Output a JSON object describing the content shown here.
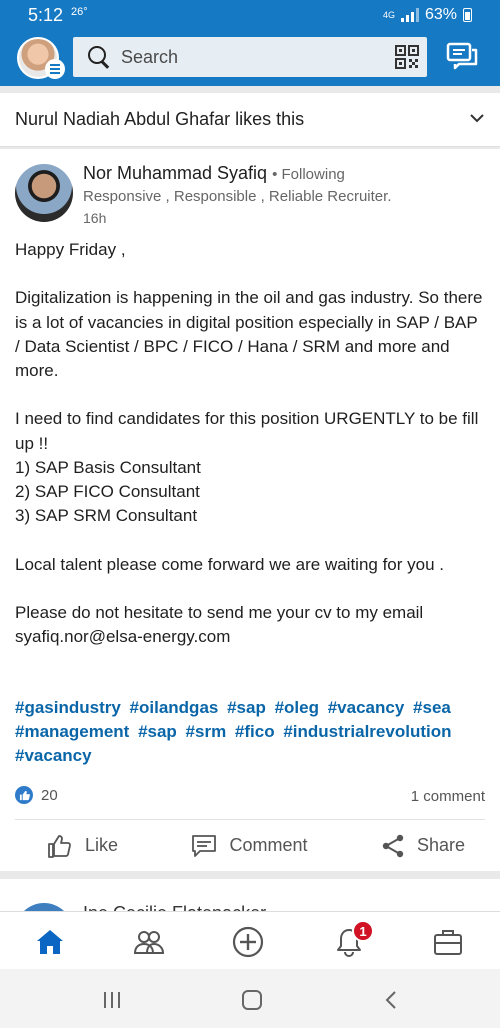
{
  "status_bar": {
    "time": "5:12",
    "temperature": "26°",
    "network": "4G",
    "battery": "63%"
  },
  "app_bar": {
    "search_placeholder": "Search",
    "icons": [
      "avatar",
      "menu-icon",
      "search-icon",
      "qr-code-icon",
      "messaging-icon"
    ]
  },
  "activity": {
    "text": "Nurul Nadiah Abdul Ghafar likes this"
  },
  "post": {
    "author_name": "Nor Muhammad Syafiq",
    "follow_status": "• Following",
    "headline": "Responsive , Responsible , Reliable Recruiter.",
    "time": "16h",
    "body": {
      "line_greeting": "Happy Friday ,",
      "para1": "Digitalization is happening in the oil and gas industry. So there is a lot of vacancies in digital position especially in SAP / BAP / Data Scientist / BPC / FICO / Hana / SRM and more and more.",
      "para2": "I need to find candidates for this position URGENTLY to be fill up !!",
      "item1": "1) SAP Basis Consultant",
      "item2": "2) SAP FICO Consultant",
      "item3": "3) SAP SRM Consultant",
      "para3": "Local talent please come forward we are waiting for you .",
      "para4_line1": "Please do not hesitate to send me your cv to my email",
      "para4_line2": "syafiq.nor@elsa-energy.com"
    },
    "hashtags": [
      "#gasindustry",
      "#oilandgas",
      "#sap",
      "#oleg",
      "#vacancy",
      "#sea",
      "#management",
      "#sap",
      "#srm",
      "#fico",
      "#industrialrevolution",
      "#vacancy"
    ],
    "reactions_count": "20",
    "comments_count": "1 comment",
    "actions": {
      "like": "Like",
      "comment": "Comment",
      "share": "Share"
    }
  },
  "next_post": {
    "author_name": "Ine Cecilie Flatenacker"
  },
  "bottom_nav": {
    "items": [
      "home",
      "my-network",
      "post",
      "notifications",
      "jobs"
    ],
    "notification_badge": "1"
  },
  "colors": {
    "brand_blue": "#1679c3",
    "hashtag_blue": "#0a66a8",
    "badge_red": "#d11124"
  }
}
